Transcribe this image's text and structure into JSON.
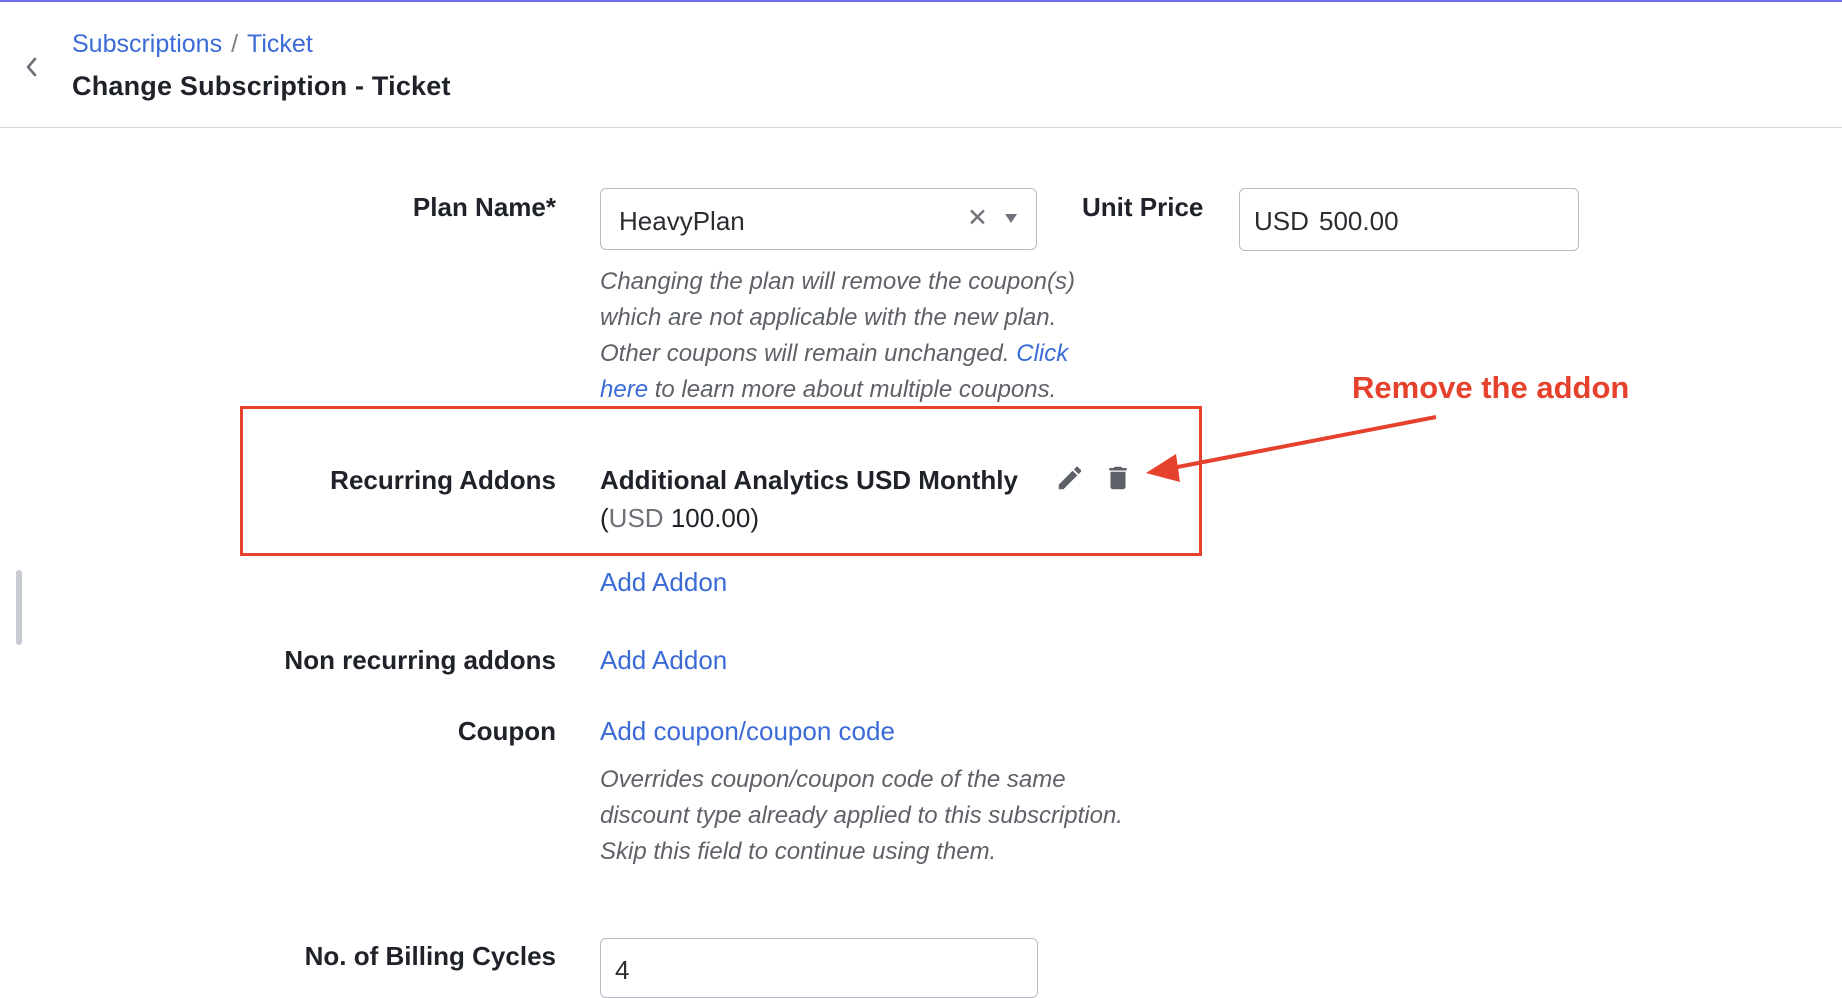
{
  "breadcrumb": {
    "items": [
      "Subscriptions",
      "Ticket"
    ],
    "separator": "/"
  },
  "page_title": "Change Subscription - Ticket",
  "plan": {
    "label": "Plan Name*",
    "value": "HeavyPlan",
    "help_part1": "Changing the plan will remove the coupon(s) which are not applicable with the new plan. Other coupons will remain unchanged. ",
    "help_link": "Click here",
    "help_part2": " to learn more about multiple coupons."
  },
  "unit_price": {
    "label": "Unit Price",
    "currency": "USD",
    "value": "500.00"
  },
  "recurring_addons": {
    "label": "Recurring Addons",
    "item_name": "Additional Analytics USD Monthly",
    "item_price_prefix": "(",
    "item_currency": "USD",
    "item_amount": "100.00)",
    "add_label": "Add Addon"
  },
  "non_recurring_addons": {
    "label": "Non recurring addons",
    "add_label": "Add Addon"
  },
  "coupon": {
    "label": "Coupon",
    "link": "Add coupon/coupon code",
    "help": "Overrides coupon/coupon code of the same discount type already applied to this subscription. Skip this field to continue using them."
  },
  "billing_cycles": {
    "label": "No. of Billing Cycles",
    "value": "4"
  },
  "annotation": {
    "text": "Remove the addon",
    "color": "#e5412d"
  },
  "icons": {
    "back": "chevron-left-icon",
    "clear": "clear-x-icon",
    "dropdown": "dropdown-arrow-icon",
    "edit": "pencil-icon",
    "delete": "trash-icon"
  },
  "colors": {
    "link": "#3b6bd6",
    "accent_top": "#6f6cf0",
    "annotation": "#e5412d"
  }
}
